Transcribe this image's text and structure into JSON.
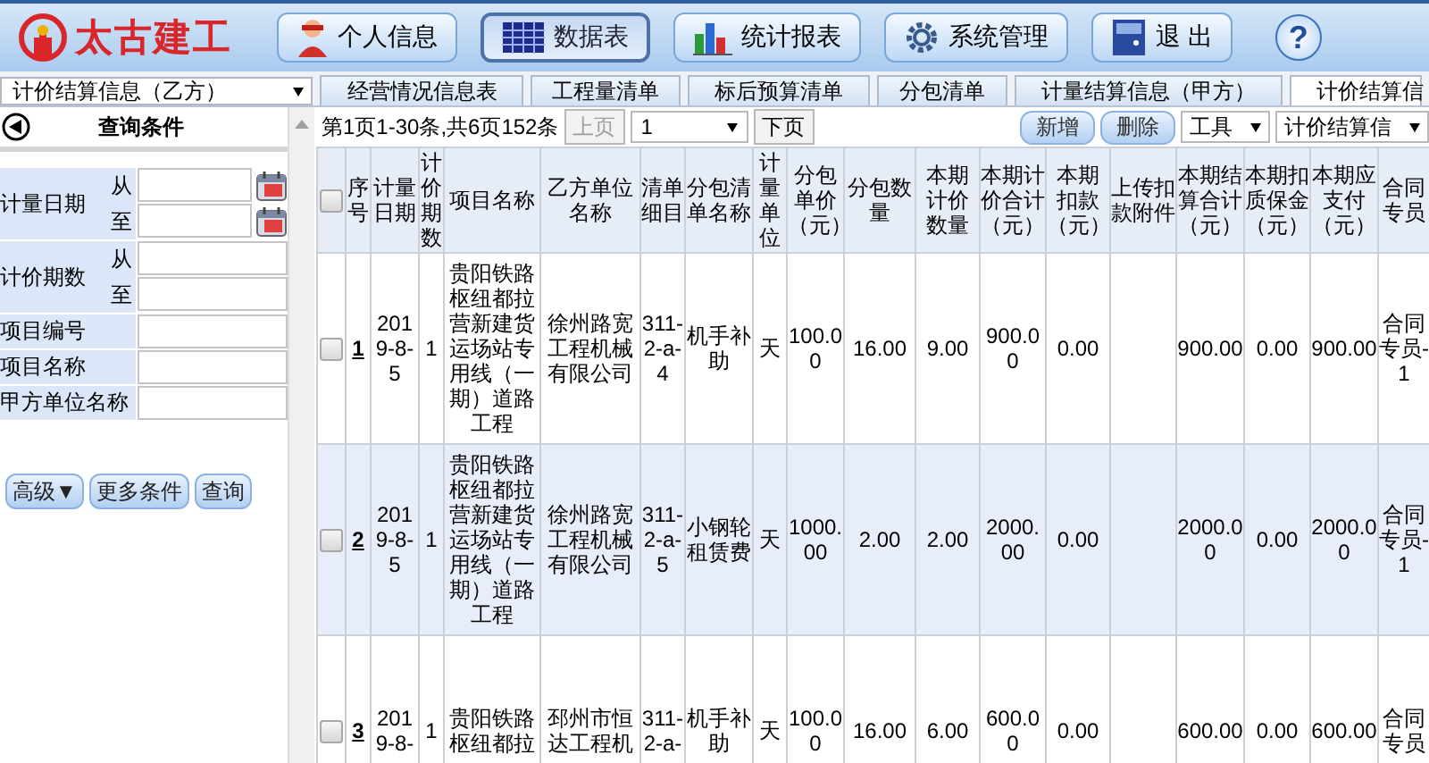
{
  "logo": {
    "text": "太古建工"
  },
  "nav": [
    {
      "label": "个人信息",
      "selected": false
    },
    {
      "label": "数据表",
      "selected": true
    },
    {
      "label": "统计报表",
      "selected": false
    },
    {
      "label": "系统管理",
      "selected": false
    },
    {
      "label": "退 出",
      "selected": false
    }
  ],
  "help": {
    "label": "?"
  },
  "module_select": {
    "value": "计价结算信息（乙方）"
  },
  "tabs": [
    {
      "label": "经营情况信息表",
      "selected": false
    },
    {
      "label": "工程量清单",
      "selected": false
    },
    {
      "label": "标后预算清单",
      "selected": false
    },
    {
      "label": "分包清单",
      "selected": false
    },
    {
      "label": "计量结算信息（甲方）",
      "selected": false
    },
    {
      "label": "计价结算信",
      "selected": true
    }
  ],
  "query_panel": {
    "title": "查询条件",
    "fields": [
      {
        "label": "计量日期",
        "kind": "date_range",
        "sub": [
          "从",
          "至"
        ]
      },
      {
        "label": "计价期数",
        "kind": "range",
        "sub": [
          "从",
          "至"
        ]
      },
      {
        "label": "项目编号",
        "kind": "text"
      },
      {
        "label": "项目名称",
        "kind": "text"
      },
      {
        "label": "甲方单位名称",
        "kind": "text"
      }
    ],
    "buttons": [
      "高级▼",
      "更多条件",
      "查询"
    ]
  },
  "pager": {
    "summary": "第1页1-30条,共6页152条",
    "prev": {
      "label": "上页",
      "disabled": true
    },
    "page": "1",
    "next": {
      "label": "下页",
      "disabled": false
    }
  },
  "actions": [
    {
      "label": "新增",
      "kind": "button"
    },
    {
      "label": "删除",
      "kind": "button"
    },
    {
      "label": "工具",
      "kind": "dropdown"
    },
    {
      "label": "计价结算信",
      "kind": "dropdown"
    }
  ],
  "table": {
    "header_checked": false,
    "columns": [
      "序号",
      "计量日期",
      "计价期数",
      "项目名称",
      "乙方单位名称",
      "清单细目",
      "分包清单名称",
      "计量单位",
      "分包单价（元）",
      "分包数量",
      "本期计价数量",
      "本期计价合计（元）",
      "本期扣款（元）",
      "上传扣款附件",
      "本期结算合计（元）",
      "本期扣质保金（元）",
      "本期应支付（元）",
      "合同专员"
    ],
    "rows": [
      {
        "checked": false,
        "cells": [
          "1",
          "2019-8-5",
          "1",
          "贵阳铁路枢纽都拉营新建货运场站专用线（一期）道路工程",
          "徐州路宽工程机械有限公司",
          "311-2-a-4",
          "机手补助",
          "天",
          "100.00",
          "16.00",
          "9.00",
          "900.00",
          "0.00",
          null,
          "900.00",
          "0.00",
          "900.00",
          "合同专员-1"
        ]
      },
      {
        "checked": false,
        "cells": [
          "2",
          "2019-8-5",
          "1",
          "贵阳铁路枢纽都拉营新建货运场站专用线（一期）道路工程",
          "徐州路宽工程机械有限公司",
          "311-2-a-5",
          "小钢轮租赁费",
          "天",
          "1000.00",
          "2.00",
          "2.00",
          "2000.00",
          "0.00",
          null,
          "2000.00",
          "0.00",
          "2000.00",
          "合同专员-1"
        ]
      },
      {
        "checked": false,
        "cells": [
          "3",
          "2019-8-",
          "1",
          "贵阳铁路枢纽都拉",
          "邳州市恒达工程机",
          "311-2-a-",
          "机手补助",
          "天",
          "100.00",
          "16.00",
          "6.00",
          "600.00",
          "0.00",
          null,
          "600.00",
          "0.00",
          "600.00",
          "合同专员"
        ]
      }
    ]
  }
}
